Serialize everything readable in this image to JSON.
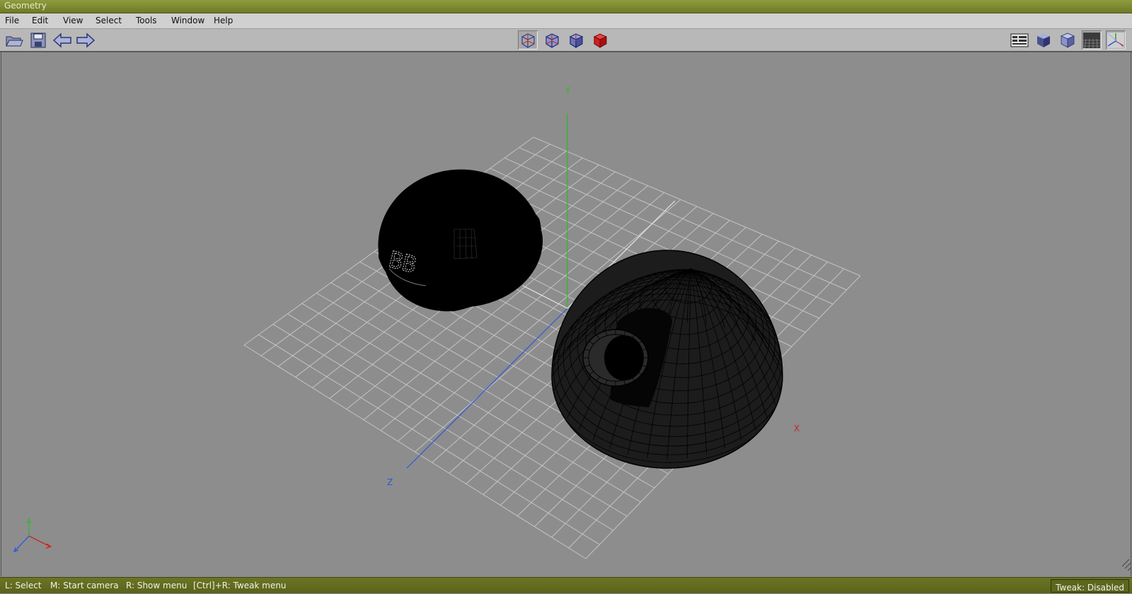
{
  "window": {
    "title": "Geometry"
  },
  "menu": [
    "File",
    "Edit",
    "View",
    "Select",
    "Tools",
    "Window",
    "Help"
  ],
  "toolbar": {
    "left": [
      "open-folder-icon",
      "save-disk-icon",
      "undo-arrow-icon",
      "redo-arrow-icon"
    ],
    "view_modes": [
      "wireframe-cube-icon",
      "smooth-wire-cube-icon",
      "shaded-wire-cube-icon",
      "solid-red-cube-icon"
    ],
    "right": [
      "info-panel-icon",
      "smooth-shade-icon",
      "flat-shade-icon",
      "ground-grid-icon",
      "axes-toggle-icon"
    ]
  },
  "viewport": {
    "axis_labels": {
      "x": "X",
      "y": "Y",
      "z": "Z"
    },
    "embossed_text": "BB",
    "colors": {
      "x_axis": "#cc2020",
      "y_axis": "#33aa22",
      "z_axis": "#2255dd",
      "grid": "#c8c8c8"
    }
  },
  "status": {
    "hints": [
      "L: Select",
      "M: Start camera",
      "R: Show menu",
      "[Ctrl]+R: Tweak menu"
    ],
    "tweak": "Tweak: Disabled"
  }
}
